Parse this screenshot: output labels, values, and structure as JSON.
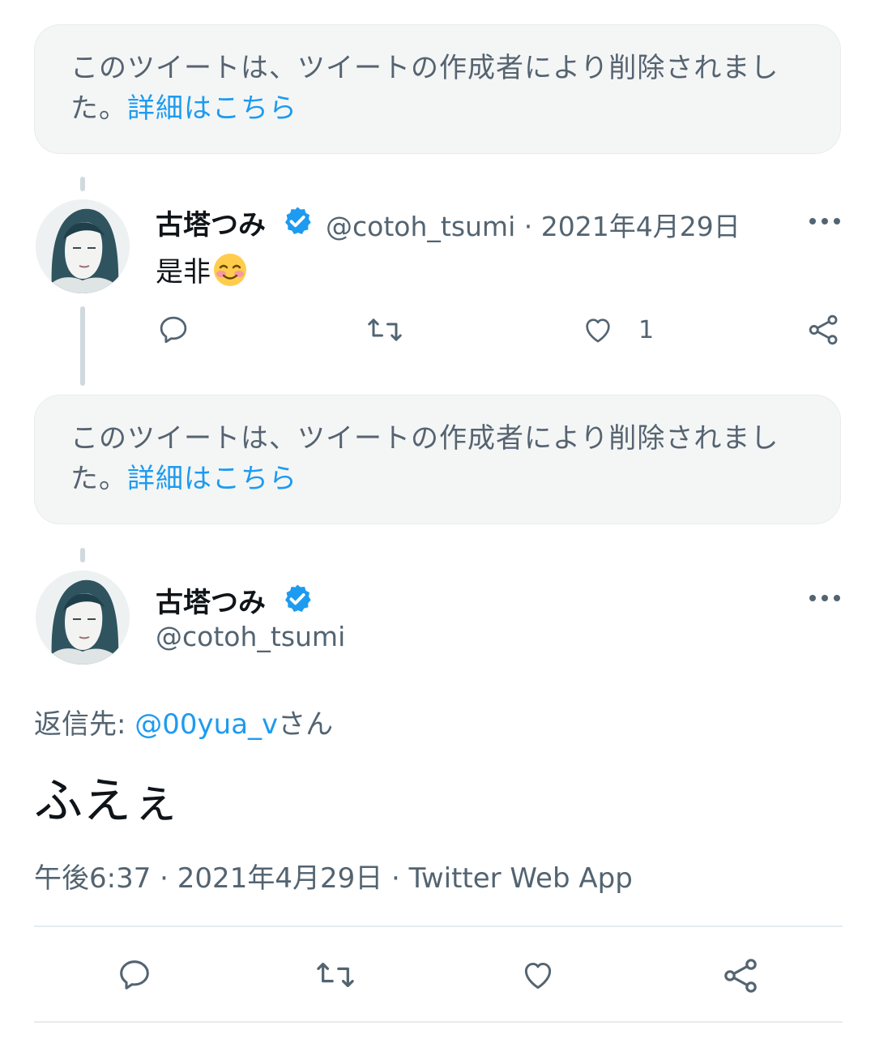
{
  "deleted_notice": {
    "text": "このツイートは、ツイートの作成者により削除されました。",
    "link": "詳細はこちら"
  },
  "tweet1": {
    "name": "古塔つみ",
    "handle": "@cotoh_tsumi",
    "separator": "·",
    "date": "2021年4月29日",
    "text": "是非",
    "emoji": "smiling-face-with-blush",
    "actions": {
      "reply_count": "",
      "retweet_count": "",
      "like_count": "1"
    }
  },
  "deleted_notice_2": {
    "text": "このツイートは、ツイートの作成者により削除されました。",
    "link": "詳細はこちら"
  },
  "main_tweet": {
    "name": "古塔つみ",
    "handle": "@cotoh_tsumi",
    "replying_label": "返信先: ",
    "replying_to": "@00yua_v",
    "replying_suffix": "さん",
    "text": "ふえぇ",
    "time": "午後6:37",
    "date": "2021年4月29日",
    "source": "Twitter Web App",
    "separator": "·"
  },
  "colors": {
    "accent": "#1d9bf0",
    "secondary_text": "#536471",
    "verified": "#1d9bf0"
  },
  "icons": [
    "verified-badge-icon",
    "more-icon",
    "reply-icon",
    "retweet-icon",
    "like-icon",
    "share-icon"
  ]
}
